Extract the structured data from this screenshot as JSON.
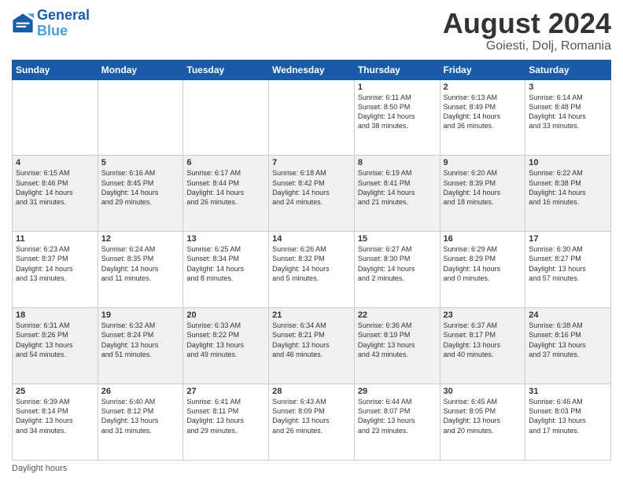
{
  "logo": {
    "line1": "General",
    "line2": "Blue"
  },
  "title": "August 2024",
  "location": "Goiesti, Dolj, Romania",
  "days_of_week": [
    "Sunday",
    "Monday",
    "Tuesday",
    "Wednesday",
    "Thursday",
    "Friday",
    "Saturday"
  ],
  "footer": "Daylight hours",
  "weeks": [
    [
      {
        "num": "",
        "info": ""
      },
      {
        "num": "",
        "info": ""
      },
      {
        "num": "",
        "info": ""
      },
      {
        "num": "",
        "info": ""
      },
      {
        "num": "1",
        "info": "Sunrise: 6:11 AM\nSunset: 8:50 PM\nDaylight: 14 hours\nand 38 minutes."
      },
      {
        "num": "2",
        "info": "Sunrise: 6:13 AM\nSunset: 8:49 PM\nDaylight: 14 hours\nand 36 minutes."
      },
      {
        "num": "3",
        "info": "Sunrise: 6:14 AM\nSunset: 8:48 PM\nDaylight: 14 hours\nand 33 minutes."
      }
    ],
    [
      {
        "num": "4",
        "info": "Sunrise: 6:15 AM\nSunset: 8:46 PM\nDaylight: 14 hours\nand 31 minutes."
      },
      {
        "num": "5",
        "info": "Sunrise: 6:16 AM\nSunset: 8:45 PM\nDaylight: 14 hours\nand 29 minutes."
      },
      {
        "num": "6",
        "info": "Sunrise: 6:17 AM\nSunset: 8:44 PM\nDaylight: 14 hours\nand 26 minutes."
      },
      {
        "num": "7",
        "info": "Sunrise: 6:18 AM\nSunset: 8:42 PM\nDaylight: 14 hours\nand 24 minutes."
      },
      {
        "num": "8",
        "info": "Sunrise: 6:19 AM\nSunset: 8:41 PM\nDaylight: 14 hours\nand 21 minutes."
      },
      {
        "num": "9",
        "info": "Sunrise: 6:20 AM\nSunset: 8:39 PM\nDaylight: 14 hours\nand 18 minutes."
      },
      {
        "num": "10",
        "info": "Sunrise: 6:22 AM\nSunset: 8:38 PM\nDaylight: 14 hours\nand 16 minutes."
      }
    ],
    [
      {
        "num": "11",
        "info": "Sunrise: 6:23 AM\nSunset: 8:37 PM\nDaylight: 14 hours\nand 13 minutes."
      },
      {
        "num": "12",
        "info": "Sunrise: 6:24 AM\nSunset: 8:35 PM\nDaylight: 14 hours\nand 11 minutes."
      },
      {
        "num": "13",
        "info": "Sunrise: 6:25 AM\nSunset: 8:34 PM\nDaylight: 14 hours\nand 8 minutes."
      },
      {
        "num": "14",
        "info": "Sunrise: 6:26 AM\nSunset: 8:32 PM\nDaylight: 14 hours\nand 5 minutes."
      },
      {
        "num": "15",
        "info": "Sunrise: 6:27 AM\nSunset: 8:30 PM\nDaylight: 14 hours\nand 2 minutes."
      },
      {
        "num": "16",
        "info": "Sunrise: 6:29 AM\nSunset: 8:29 PM\nDaylight: 14 hours\nand 0 minutes."
      },
      {
        "num": "17",
        "info": "Sunrise: 6:30 AM\nSunset: 8:27 PM\nDaylight: 13 hours\nand 57 minutes."
      }
    ],
    [
      {
        "num": "18",
        "info": "Sunrise: 6:31 AM\nSunset: 8:26 PM\nDaylight: 13 hours\nand 54 minutes."
      },
      {
        "num": "19",
        "info": "Sunrise: 6:32 AM\nSunset: 8:24 PM\nDaylight: 13 hours\nand 51 minutes."
      },
      {
        "num": "20",
        "info": "Sunrise: 6:33 AM\nSunset: 8:22 PM\nDaylight: 13 hours\nand 49 minutes."
      },
      {
        "num": "21",
        "info": "Sunrise: 6:34 AM\nSunset: 8:21 PM\nDaylight: 13 hours\nand 46 minutes."
      },
      {
        "num": "22",
        "info": "Sunrise: 6:36 AM\nSunset: 8:19 PM\nDaylight: 13 hours\nand 43 minutes."
      },
      {
        "num": "23",
        "info": "Sunrise: 6:37 AM\nSunset: 8:17 PM\nDaylight: 13 hours\nand 40 minutes."
      },
      {
        "num": "24",
        "info": "Sunrise: 6:38 AM\nSunset: 8:16 PM\nDaylight: 13 hours\nand 37 minutes."
      }
    ],
    [
      {
        "num": "25",
        "info": "Sunrise: 6:39 AM\nSunset: 8:14 PM\nDaylight: 13 hours\nand 34 minutes."
      },
      {
        "num": "26",
        "info": "Sunrise: 6:40 AM\nSunset: 8:12 PM\nDaylight: 13 hours\nand 31 minutes."
      },
      {
        "num": "27",
        "info": "Sunrise: 6:41 AM\nSunset: 8:11 PM\nDaylight: 13 hours\nand 29 minutes."
      },
      {
        "num": "28",
        "info": "Sunrise: 6:43 AM\nSunset: 8:09 PM\nDaylight: 13 hours\nand 26 minutes."
      },
      {
        "num": "29",
        "info": "Sunrise: 6:44 AM\nSunset: 8:07 PM\nDaylight: 13 hours\nand 23 minutes."
      },
      {
        "num": "30",
        "info": "Sunrise: 6:45 AM\nSunset: 8:05 PM\nDaylight: 13 hours\nand 20 minutes."
      },
      {
        "num": "31",
        "info": "Sunrise: 6:46 AM\nSunset: 8:03 PM\nDaylight: 13 hours\nand 17 minutes."
      }
    ]
  ]
}
